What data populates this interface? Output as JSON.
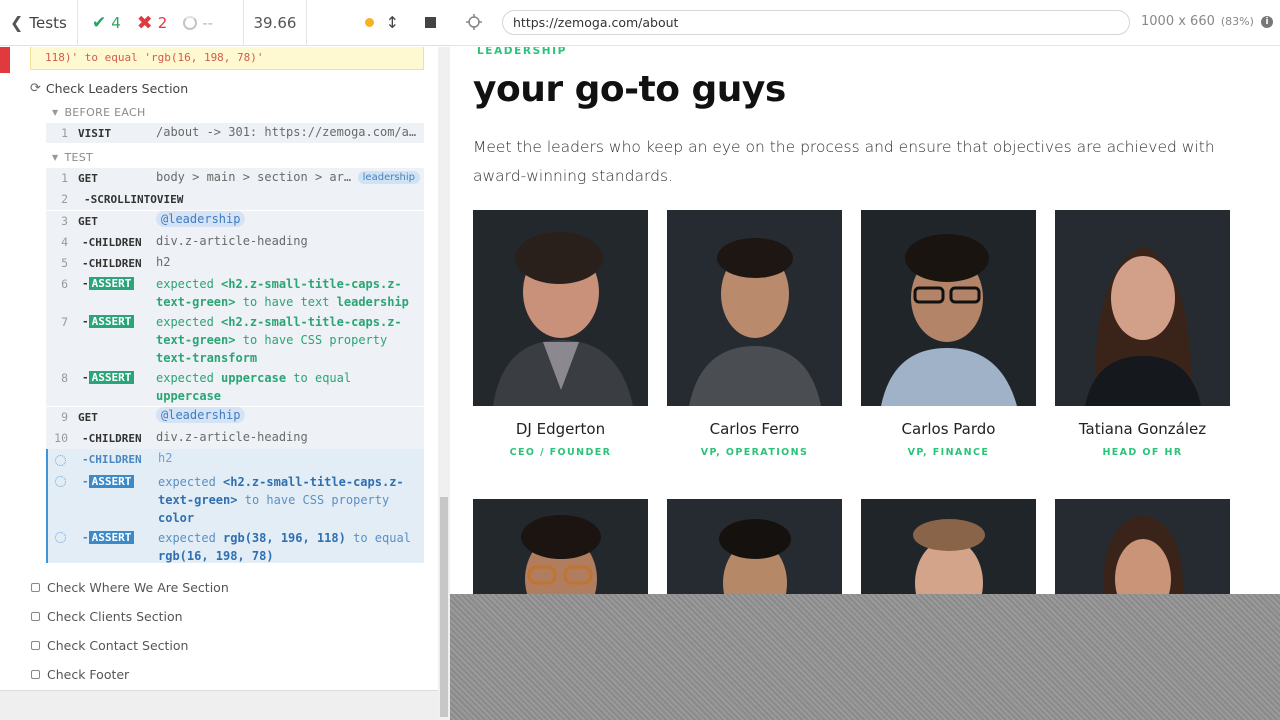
{
  "reporter": {
    "back_label": "Tests",
    "passed": "4",
    "failed": "2",
    "pending": "--",
    "duration": "39.66",
    "error_line1": "'",
    "error_line2": "118)' to equal 'rgb(16, 198, 78)'",
    "suite_title": "Check Leaders Section",
    "before_each_label": "BEFORE EACH",
    "test_label": "TEST",
    "commands": [
      {
        "num": "1",
        "name": "VISIT",
        "msg": "/about -> 301: https://zemoga.com/a…"
      },
      {
        "num": "1",
        "name": "GET",
        "msg": "body > main > section > ar…",
        "badge": "leadership"
      },
      {
        "num": "2",
        "name": "-SCROLLINTOVIEW",
        "msg": ""
      },
      {
        "num": "3",
        "name": "GET",
        "alias": "@leadership"
      },
      {
        "num": "4",
        "name": "-CHILDREN",
        "msg": "div.z-article-heading"
      },
      {
        "num": "5",
        "name": "-CHILDREN",
        "msg": "h2"
      },
      {
        "num": "6",
        "name": "-",
        "tag": "ASSERT",
        "p1": "expected",
        "p2": "<h2.z-small-title-caps.z-text-green>",
        "p3": "to have text",
        "p4": "leadership"
      },
      {
        "num": "7",
        "name": "-",
        "tag": "ASSERT",
        "p1": "expected",
        "p2": "<h2.z-small-title-caps.z-text-green>",
        "p3": "to have CSS property",
        "p4": "text-transform"
      },
      {
        "num": "8",
        "name": "-",
        "tag": "ASSERT",
        "p1": "expected",
        "p2": "uppercase",
        "p3": "to equal",
        "p4": "uppercase"
      },
      {
        "num": "9",
        "name": "GET",
        "alias": "@leadership"
      },
      {
        "num": "10",
        "name": "-CHILDREN",
        "msg": "div.z-article-heading"
      },
      {
        "num": "",
        "name": "-CHILDREN",
        "msg": "h2"
      },
      {
        "num": "",
        "name": "-",
        "tag": "ASSERT",
        "p1": "expected",
        "p2": "<h2.z-small-title-caps.z-text-green>",
        "p3": "to have CSS property",
        "p4": "color"
      },
      {
        "num": "",
        "name": "-",
        "tag": "ASSERT",
        "p1": "expected",
        "p2": "rgb(38, 196, 118)",
        "p3": "to equal",
        "p4": "rgb(16, 198, 78)"
      }
    ],
    "pending_tests": [
      "Check Where We Are Section",
      "Check Clients Section",
      "Check Contact Section",
      "Check Footer"
    ]
  },
  "aut": {
    "url": "https://zemoga.com/about",
    "viewport": "1000 x 660",
    "scale": "(83%)",
    "site": {
      "kicker": "LEADERSHIP",
      "title": "your go-to guys",
      "lead": "Meet the leaders who keep an eye on the process and ensure that objectives are achieved with award-winning standards.",
      "leaders": [
        {
          "name": "DJ Edgerton",
          "role": "CEO / FOUNDER"
        },
        {
          "name": "Carlos Ferro",
          "role": "VP, OPERATIONS"
        },
        {
          "name": "Carlos Pardo",
          "role": "VP, FINANCE"
        },
        {
          "name": "Tatiana González",
          "role": "HEAD OF HR"
        }
      ]
    }
  },
  "colors": {
    "pass": "#2aa55f",
    "fail": "#e0393e",
    "brand_green": "#2bc37a",
    "active_blue": "#3f93d7"
  }
}
